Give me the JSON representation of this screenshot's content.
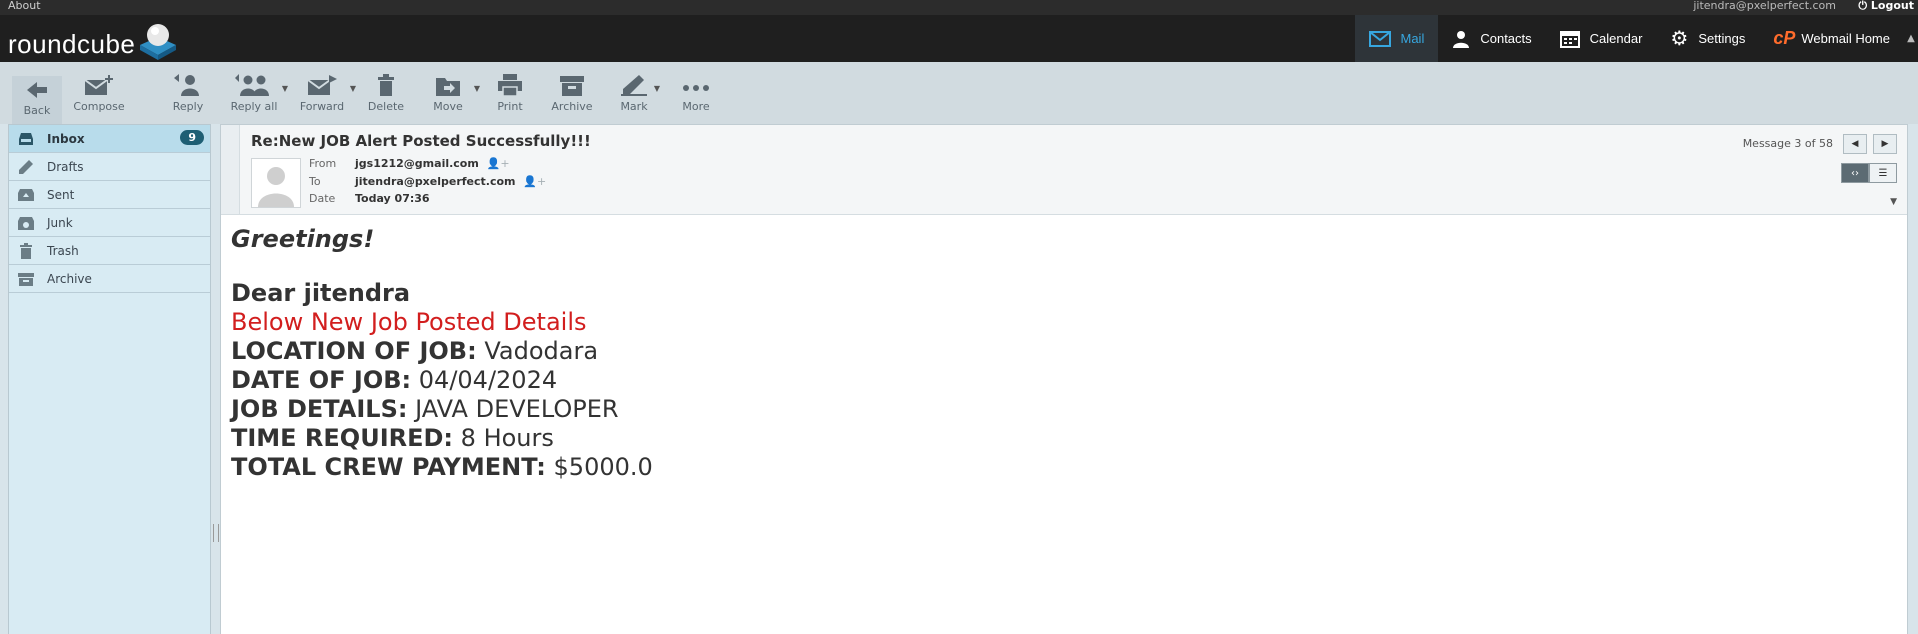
{
  "topbar": {
    "about": "About",
    "user_email": "jitendra@pxelperfect.com",
    "logout": "Logout"
  },
  "header": {
    "logo": "roundcube",
    "nav": [
      {
        "label": "Mail",
        "icon": "envelope-icon",
        "active": true
      },
      {
        "label": "Contacts",
        "icon": "person-icon"
      },
      {
        "label": "Calendar",
        "icon": "calendar-icon"
      },
      {
        "label": "Settings",
        "icon": "gear-icon"
      },
      {
        "label": "Webmail Home",
        "icon": "cpanel-icon"
      }
    ]
  },
  "toolbar": {
    "back": "Back",
    "compose": "Compose",
    "reply": "Reply",
    "reply_all": "Reply all",
    "forward": "Forward",
    "delete": "Delete",
    "move": "Move",
    "print": "Print",
    "archive": "Archive",
    "mark": "Mark",
    "more": "More"
  },
  "folders": [
    {
      "label": "Inbox",
      "icon": "inbox-icon",
      "count": "9",
      "active": true
    },
    {
      "label": "Drafts",
      "icon": "pencil-icon"
    },
    {
      "label": "Sent",
      "icon": "sent-icon"
    },
    {
      "label": "Junk",
      "icon": "junk-icon"
    },
    {
      "label": "Trash",
      "icon": "trash-icon"
    },
    {
      "label": "Archive",
      "icon": "archive-icon"
    }
  ],
  "message": {
    "subject": "Re:New JOB Alert Posted Successfully!!!",
    "from_label": "From",
    "from": "jgs1212@gmail.com",
    "to_label": "To",
    "to": "jitendra@pxelperfect.com",
    "date_label": "Date",
    "date": "Today 07:36",
    "counter": "Message 3 of 58",
    "body": {
      "greeting": "Greetings!",
      "dear": "Dear jitendra",
      "details_heading": "Below New Job Posted Details",
      "location_label": "LOCATION OF JOB:",
      "location": "Vadodara",
      "date_label": "DATE OF JOB:",
      "date": "04/04/2024",
      "details_label": "JOB DETAILS:",
      "details": "JAVA DEVELOPER",
      "time_label": "TIME REQUIRED:",
      "time": "8 Hours",
      "payment_label": "TOTAL CREW PAYMENT:",
      "payment": "$5000.0"
    }
  },
  "colors": {
    "accent": "#37a7e0",
    "red_text": "#d21e1e",
    "badge": "#1e5f74"
  }
}
